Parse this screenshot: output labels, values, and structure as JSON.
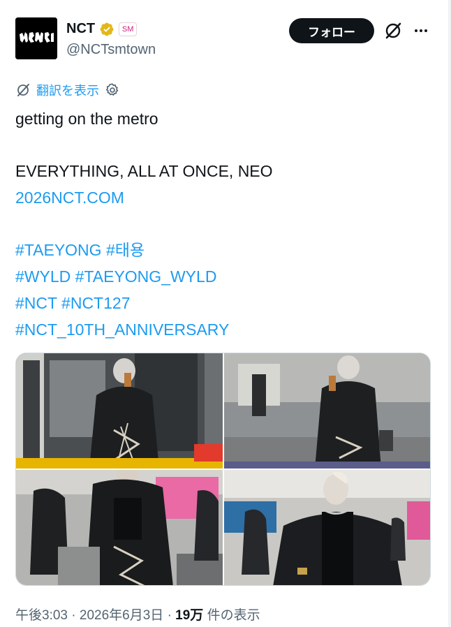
{
  "author": {
    "display_name": "NCT",
    "handle": "@NCTsmtown",
    "affiliation_badge": "SM"
  },
  "actions": {
    "follow_label": "フォロー",
    "more_label": "…"
  },
  "translate": {
    "label": "翻訳を表示"
  },
  "tweet": {
    "line1": "getting on the metro",
    "line2": "EVERYTHING, ALL AT ONCE, NEO",
    "link": "2026NCT.COM",
    "hashtags_line1": [
      "#TAEYONG",
      "#태용"
    ],
    "hashtags_line2": [
      "#WYLD",
      "#TAEYONG_WYLD"
    ],
    "hashtags_line3": [
      "#NCT",
      "#NCT127"
    ],
    "hashtags_line4": [
      "#NCT_10TH_ANNIVERSARY"
    ]
  },
  "meta": {
    "time": "午後3:03",
    "date": "2026年6月3日",
    "views_count": "19万",
    "views_label": "件の表示",
    "separator": "·"
  },
  "colors": {
    "accent": "#1d9bf0",
    "text": "#0f1419",
    "muted": "#536471",
    "verified_gold": "#e2b719"
  }
}
